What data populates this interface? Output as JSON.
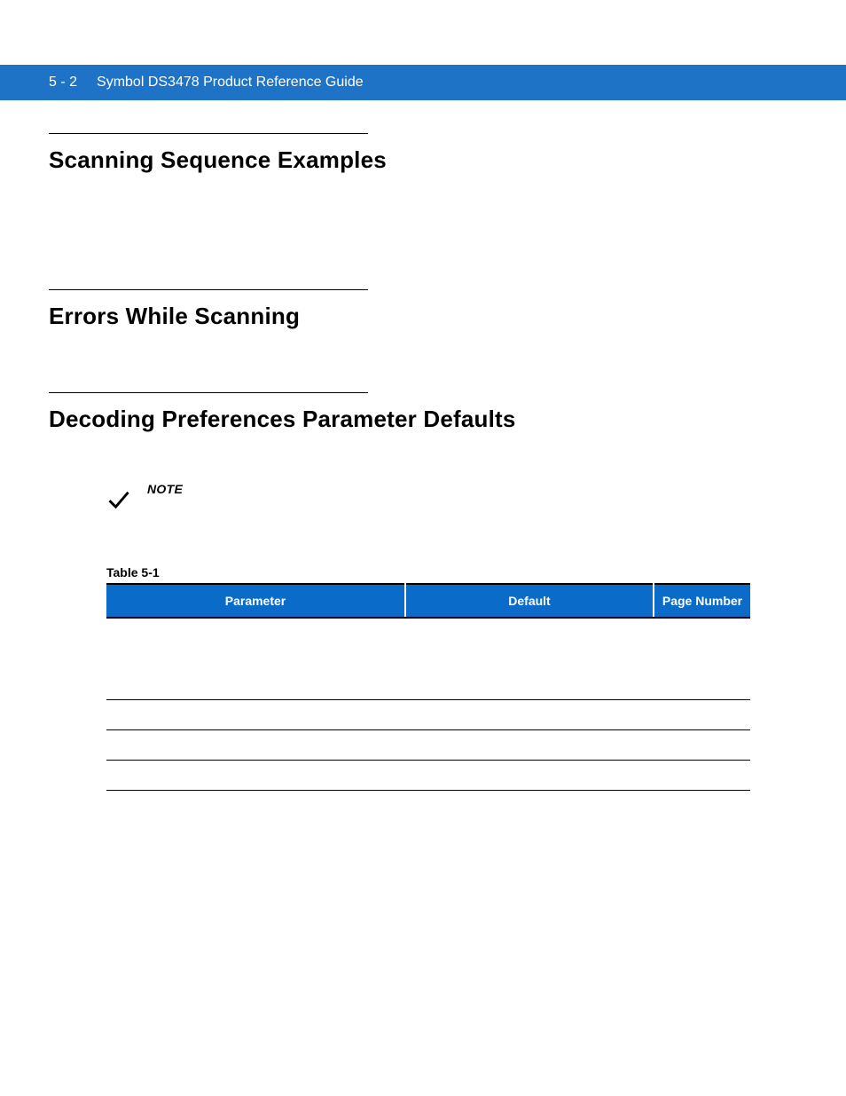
{
  "header": {
    "page_number": "5 - 2",
    "doc_title": "Symbol DS3478 Product Reference Guide"
  },
  "sections": {
    "s1_title": "Scanning Sequence Examples",
    "s2_title": "Errors While Scanning",
    "s3_title": "Decoding Preferences Parameter Defaults"
  },
  "note": {
    "label": "NOTE"
  },
  "table": {
    "caption": "Table 5-1",
    "headers": {
      "parameter": "Parameter",
      "default": "Default",
      "page_number": "Page Number"
    },
    "rows": [
      {
        "parameter": "",
        "default": "",
        "page_number": ""
      },
      {
        "parameter": "",
        "default": "",
        "page_number": ""
      },
      {
        "parameter": "",
        "default": "",
        "page_number": ""
      },
      {
        "parameter": "",
        "default": "",
        "page_number": ""
      }
    ]
  }
}
